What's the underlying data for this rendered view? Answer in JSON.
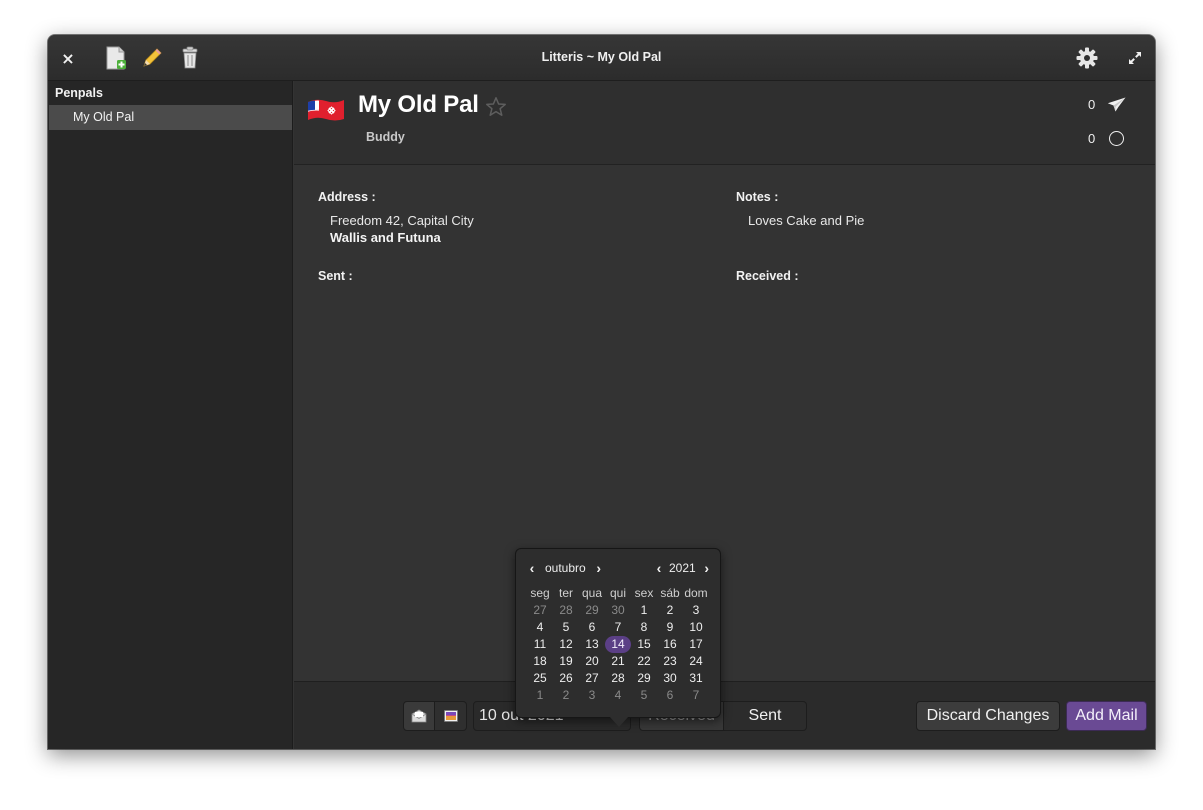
{
  "window": {
    "title": "Litteris ~ My Old Pal",
    "close_label": "×"
  },
  "sidebar": {
    "heading": "Penpals",
    "items": [
      {
        "label": "My Old Pal",
        "selected": true
      }
    ]
  },
  "penpal": {
    "name": "My Old Pal",
    "subtitle": "Buddy",
    "flag": "Wallis and Futuna",
    "starred": false,
    "sent_count": "0",
    "received_count": "0",
    "address_label": "Address :",
    "address_line1": "Freedom 42, Capital City",
    "address_country": "Wallis and Futuna",
    "notes_label": "Notes :",
    "notes": "Loves Cake and Pie",
    "sent_label": "Sent :",
    "received_label": "Received :"
  },
  "actionbar": {
    "date_value": "10 out 2021",
    "type_options": [
      "Received",
      "Sent"
    ],
    "type_selected": "Sent",
    "discard_label": "Discard Changes",
    "add_label": "Add Mail"
  },
  "calendar": {
    "month": "outubro",
    "year": "2021",
    "weekdays": [
      "seg",
      "ter",
      "qua",
      "qui",
      "sex",
      "sáb",
      "dom"
    ],
    "weeks": [
      [
        "27",
        "28",
        "29",
        "30",
        "1",
        "2",
        "3"
      ],
      [
        "4",
        "5",
        "6",
        "7",
        "8",
        "9",
        "10"
      ],
      [
        "11",
        "12",
        "13",
        "14",
        "15",
        "16",
        "17"
      ],
      [
        "18",
        "19",
        "20",
        "21",
        "22",
        "23",
        "24"
      ],
      [
        "25",
        "26",
        "27",
        "28",
        "29",
        "30",
        "31"
      ],
      [
        "1",
        "2",
        "3",
        "4",
        "5",
        "6",
        "7"
      ]
    ],
    "selected_day": "14"
  },
  "colors": {
    "accent": "#6a4a94",
    "selected_day": "#5b3f86",
    "window_bg": "#333333",
    "sidebar_bg": "#262626"
  },
  "icons": {
    "close": "close-icon",
    "new": "new-document-icon",
    "edit": "pencil-icon",
    "delete": "trash-icon",
    "settings": "gear-icon",
    "fullscreen": "fullscreen-icon",
    "star": "star-icon",
    "sent": "paper-plane-icon",
    "received": "circle-icon",
    "letter": "envelope-icon",
    "postcard": "postcard-icon"
  }
}
